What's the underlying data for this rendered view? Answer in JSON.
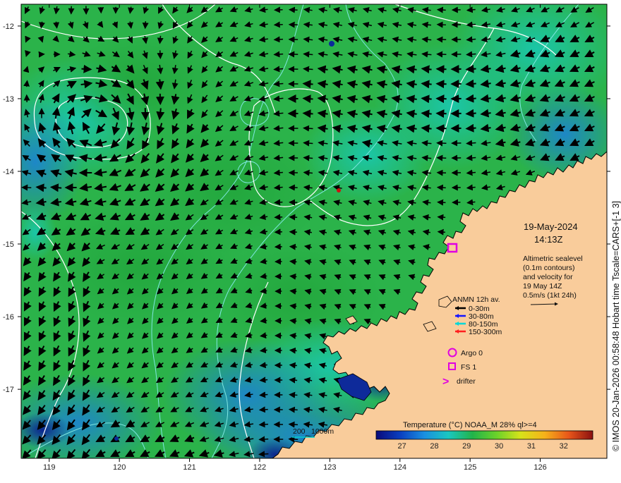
{
  "map": {
    "lon_range": [
      118.6,
      126.95
    ],
    "lat_range": [
      -17.95,
      -11.7
    ],
    "lon_ticks": [
      "119",
      "120",
      "121",
      "122",
      "123",
      "124",
      "125",
      "126"
    ],
    "lat_ticks": [
      "-12",
      "-13",
      "-14",
      "-15",
      "-16",
      "-17"
    ],
    "colors": {
      "ocean_main": "#2bb34a",
      "ocean_light": "#1bc7b0",
      "ocean_cool": "#1a8fd6",
      "ocean_deep": "#0a2a9a",
      "land": "#f9cc9b",
      "coast": "#000000",
      "contour": "#ffffff",
      "bathymetry": "#7fe6e0",
      "marker": "#e000e0"
    }
  },
  "annotations": {
    "date": "19-May-2024",
    "time": "14:13Z",
    "description_lines": [
      "Altimetric sealevel",
      "(0.1m contours)",
      "and velocity for",
      "19 May 14Z",
      "0.5m/s (1kt 24h)"
    ]
  },
  "mooring_legend": {
    "title": "ANMN 12h av.",
    "items": [
      {
        "label": "0-30m",
        "color": "#000000"
      },
      {
        "label": "30-80m",
        "color": "#1515ff"
      },
      {
        "label": "80-150m",
        "color": "#00d8d8"
      },
      {
        "label": "150-300m",
        "color": "#ff1e1e"
      }
    ]
  },
  "symbol_legend": {
    "argo": "Argo 0",
    "fs": "FS 1",
    "drifter": "drifter",
    "drifter_symbol": ">"
  },
  "scale_bar": {
    "label_a": "200",
    "label_b": "1000m"
  },
  "colorbar": {
    "title": "Temperature (°C) NOAA_M 28% ql>=4",
    "ticks": [
      "27",
      "28",
      "29",
      "30",
      "31",
      "32"
    ],
    "range": [
      26.2,
      32.9
    ],
    "stops": [
      "#0a0a7a",
      "#0a3fc0",
      "#1a8fe0",
      "#1ac7c0",
      "#22b34a",
      "#6ad22a",
      "#d7e21a",
      "#f5b21a",
      "#e8561a",
      "#8a1010"
    ]
  },
  "credit": "© IMOS 20-Jan-2026 00:58:48 Hobart time Tscale=CARS+[-1 3]"
}
